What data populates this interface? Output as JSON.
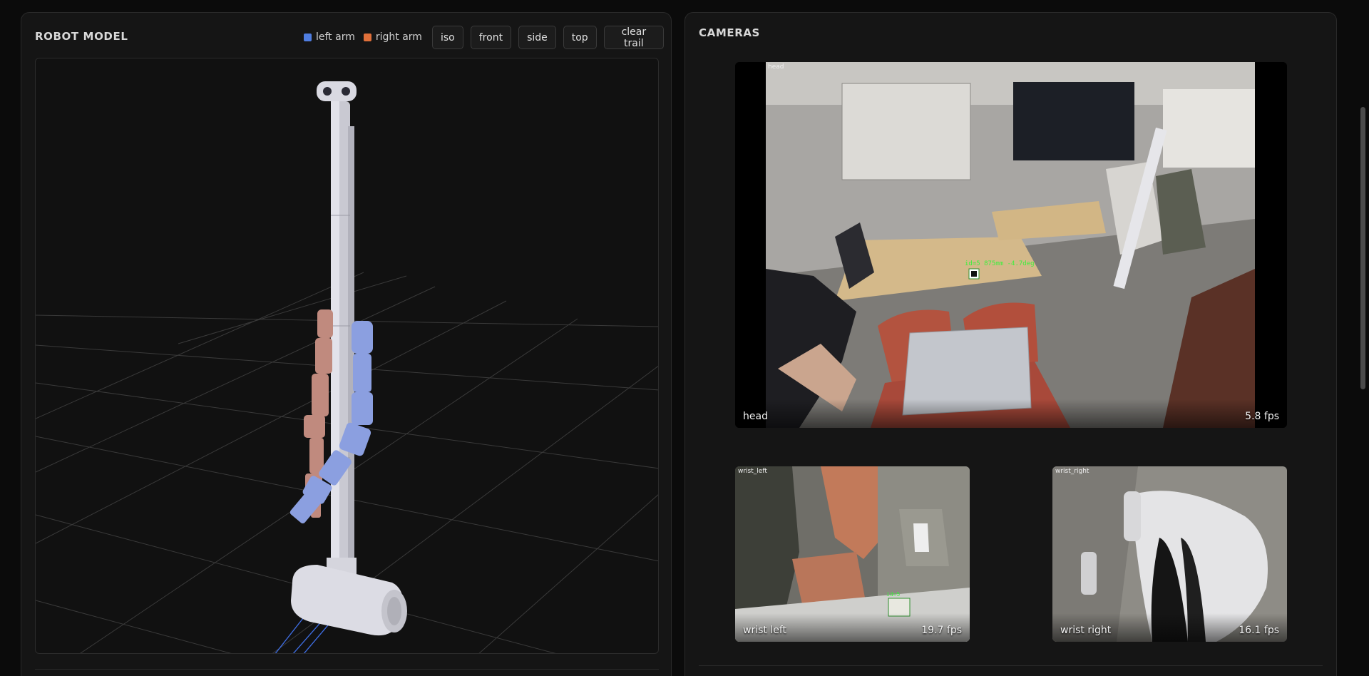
{
  "robot_panel": {
    "title": "ROBOT MODEL",
    "legend": [
      {
        "label": "left arm",
        "color": "#4f7de0"
      },
      {
        "label": "right arm",
        "color": "#e0703a"
      }
    ],
    "view_buttons": [
      "iso",
      "front",
      "side",
      "top"
    ],
    "clear_trail_label": "clear trail"
  },
  "colors": {
    "left_arm_model": "#8b9fe0",
    "right_arm_model": "#c08a7e",
    "robot_body": "#d6d6de",
    "trail": "#3f6fe6"
  },
  "cameras_panel": {
    "title": "CAMERAS",
    "cameras": [
      {
        "tag": "head",
        "label": "head",
        "fps": "5.8 fps"
      },
      {
        "tag": "wrist_left",
        "label": "wrist left",
        "fps": "19.7 fps"
      },
      {
        "tag": "wrist_right",
        "label": "wrist right",
        "fps": "16.1 fps"
      }
    ],
    "head_overlay_text": "id=5  875mm  -4.7deg",
    "wrist_left_overlay_text": "id=5"
  }
}
